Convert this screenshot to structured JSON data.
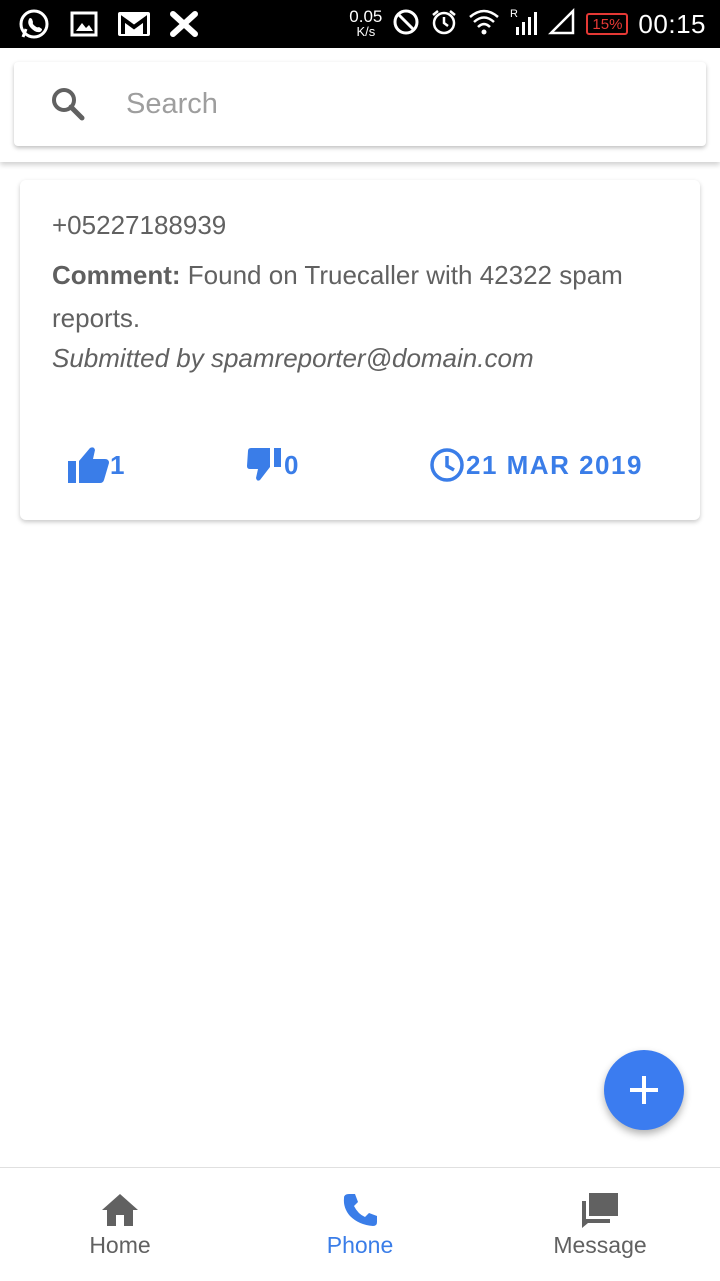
{
  "status_bar": {
    "netspeed_value": "0.05",
    "netspeed_unit": "K/s",
    "battery": "15%",
    "time": "00:15",
    "left_icons": [
      "whatsapp-icon",
      "gallery-icon",
      "gmail-icon",
      "x-app-icon"
    ],
    "right_icons": [
      "dnd-icon",
      "alarm-icon",
      "wifi-icon",
      "signal-icon",
      "signal-empty-icon",
      "battery-icon"
    ]
  },
  "search": {
    "placeholder": "Search",
    "value": ""
  },
  "report": {
    "phone": "+05227188939",
    "comment_label": "Comment:",
    "comment_text": " Found on Truecaller with 42322 spam reports.",
    "submitted_by": "Submitted by spamreporter@domain.com",
    "upvotes": "1",
    "downvotes": "0",
    "date": "21 MAR 2019"
  },
  "fab": {
    "icon": "plus-icon"
  },
  "bottom_nav": {
    "items": [
      {
        "label": "Home",
        "icon": "home-icon",
        "active": false
      },
      {
        "label": "Phone",
        "icon": "phone-icon",
        "active": true
      },
      {
        "label": "Message",
        "icon": "message-icon",
        "active": false
      }
    ]
  },
  "colors": {
    "accent": "#3a7de8",
    "fab": "#3b7cf0",
    "text_secondary": "#616161",
    "battery_low": "#e53935"
  }
}
